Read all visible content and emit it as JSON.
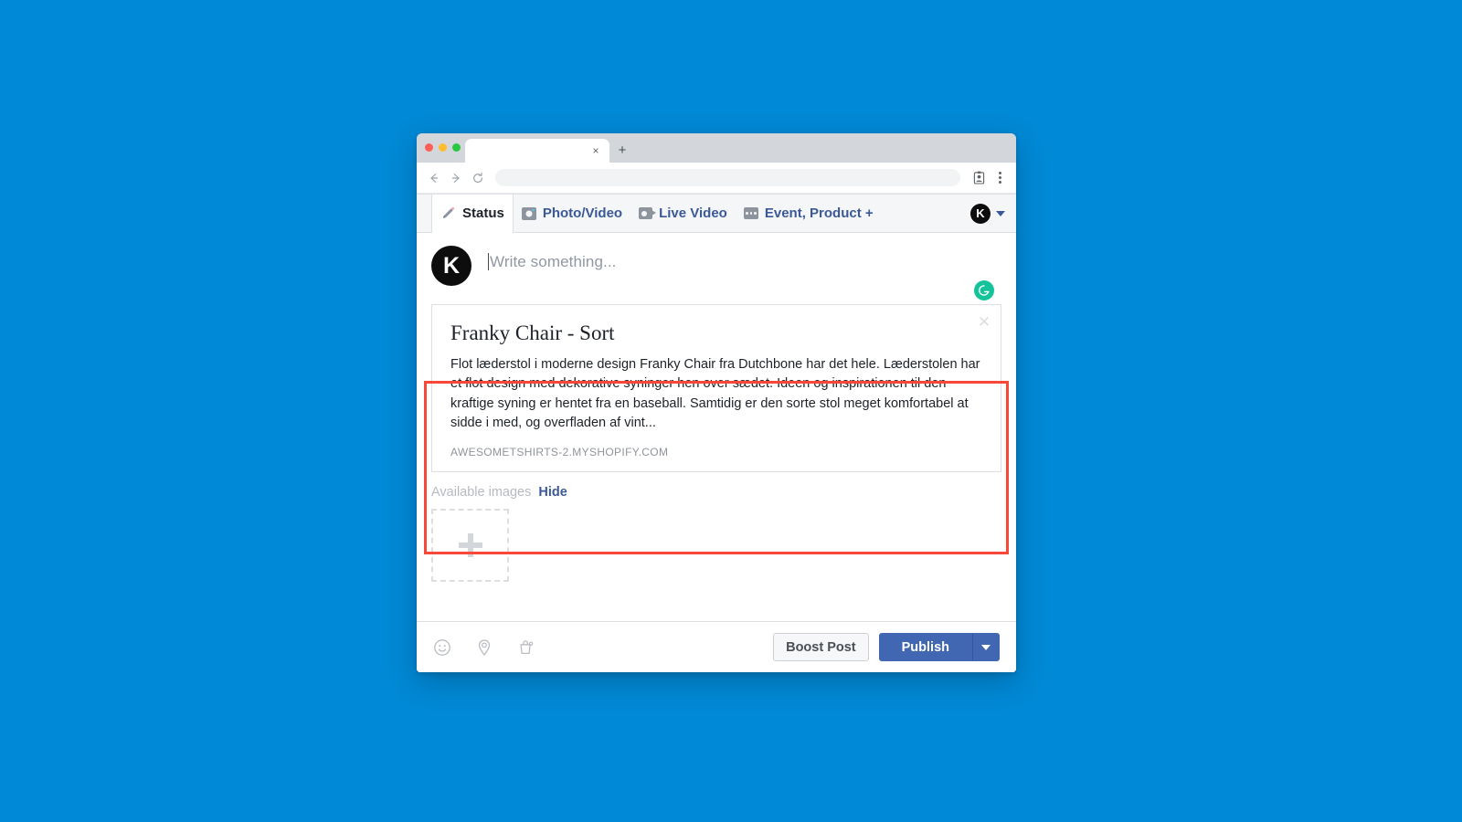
{
  "browser": {
    "tab_title": "",
    "tab_close_glyph": "×",
    "new_tab_glyph": "+",
    "back_icon": "back-arrow-icon",
    "forward_icon": "forward-arrow-icon",
    "reload_icon": "reload-icon",
    "address_value": "",
    "address_placeholder": "",
    "profile_icon": "profile-card-icon",
    "menu_icon": "kebab-menu-icon",
    "traffic_lights": [
      "close",
      "minimize",
      "maximize"
    ]
  },
  "composer": {
    "tabs": [
      {
        "label": "Status",
        "icon": "pencil-icon",
        "active": true
      },
      {
        "label": "Photo/Video",
        "icon": "camera-icon",
        "active": false
      },
      {
        "label": "Live Video",
        "icon": "video-camera-icon",
        "active": false
      },
      {
        "label": "Event, Product +",
        "icon": "dots-square-icon",
        "active": false
      }
    ],
    "account": {
      "avatar_initial": "K",
      "caret_icon": "chevron-down-icon"
    },
    "status": {
      "avatar_initial": "K",
      "placeholder": "Write something...",
      "value": "",
      "grammarly_icon": "grammarly-icon",
      "grammarly_glyph": "G"
    },
    "link_preview": {
      "title": "Franky Chair - Sort",
      "description": "Flot læderstol i moderne design Franky Chair fra Dutchbone har det hele. Læderstolen har et flot design med dekorative syninger hen over sædet. Ideen og inspirationen til den kraftige syning er hentet fra en baseball. Samtidig er den sorte stol meget komfortabel at sidde i med, og overfladen af vint...",
      "domain": "AWESOMETSHIRTS-2.MYSHOPIFY.COM",
      "close_glyph": "✕",
      "close_icon": "close-icon",
      "highlight_color": "#f9483a"
    },
    "available_images": {
      "label": "Available images",
      "hide_label": "Hide",
      "add_icon": "plus-icon"
    },
    "toolbar": {
      "icons": [
        {
          "name": "emoji-icon"
        },
        {
          "name": "location-pin-icon"
        },
        {
          "name": "shopping-tag-icon"
        }
      ],
      "boost_label": "Boost Post",
      "publish_label": "Publish",
      "publish_caret_icon": "chevron-down-icon",
      "publish_color": "#4267b2"
    }
  },
  "page_background": "#0089d6"
}
